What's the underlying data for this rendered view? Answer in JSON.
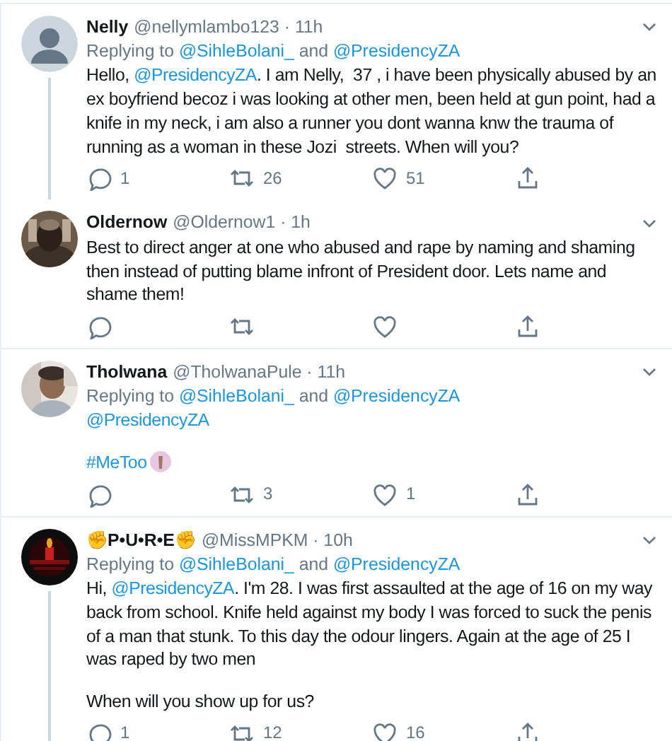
{
  "tweets": [
    {
      "avatar": {
        "kind": "default"
      },
      "thread_line": true,
      "name": [
        {
          "text": "Nelly",
          "kind": "plain"
        }
      ],
      "handle": "@nellymlambo123",
      "separator": "·",
      "time": "11h",
      "replying": {
        "prefix": "Replying to",
        "targets": [
          "@SihleBolani_",
          "@PresidencyZA"
        ],
        "joiner": "and"
      },
      "body": [
        [
          {
            "text": "Hello, ",
            "kind": "plain"
          },
          {
            "text": "@PresidencyZA",
            "kind": "mention"
          },
          {
            "text": ". I am Nelly,  37 , i have been physically abused by an ex boyfriend becoz i was looking at other men, been held at gun point, had a knife in my neck, i am also a runner you dont wanna knw the trauma of running as a woman in these Jozi  streets. When will you?",
            "kind": "plain"
          }
        ]
      ],
      "stats": {
        "replies": "1",
        "retweets": "26",
        "likes": "51"
      }
    },
    {
      "avatar": {
        "kind": "picture"
      },
      "thread_line": false,
      "name": [
        {
          "text": "Oldernow",
          "kind": "plain"
        }
      ],
      "handle": "@Oldernow1",
      "separator": "·",
      "time": "1h",
      "body": [
        [
          {
            "text": "Best to direct anger at one who abused and rape by naming and shaming then instead of putting blame infront of President door. Lets name and shame them!",
            "kind": "plain"
          }
        ]
      ]
    },
    {
      "avatar": {
        "kind": "picture"
      },
      "thread_line": false,
      "name": [
        {
          "text": "Tholwana",
          "kind": "plain"
        }
      ],
      "handle": "@TholwanaPule",
      "separator": "·",
      "time": "11h",
      "replying": {
        "prefix": "Replying to",
        "targets": [
          "@SihleBolani_",
          "@PresidencyZA"
        ],
        "joiner": "and"
      },
      "body": [
        [
          {
            "text": "@PresidencyZA",
            "kind": "mention"
          }
        ],
        [
          {
            "text": "#MeToo",
            "kind": "mention"
          },
          {
            "kind": "emoji-icon"
          }
        ]
      ],
      "stats": {
        "retweets": "3",
        "likes": "1"
      }
    },
    {
      "avatar": {
        "kind": "picture"
      },
      "thread_line": true,
      "name": [
        {
          "text": "✊",
          "kind": "emoji"
        },
        {
          "text": "P•U•R•E",
          "kind": "plain"
        },
        {
          "text": "✊",
          "kind": "emoji"
        }
      ],
      "handle": "@MissMPKM",
      "separator": "·",
      "time": "10h",
      "replying": {
        "prefix": "Replying to",
        "targets": [
          "@SihleBolani_",
          "@PresidencyZA"
        ],
        "joiner": "and"
      },
      "body": [
        [
          {
            "text": "Hi, ",
            "kind": "plain"
          },
          {
            "text": "@PresidencyZA",
            "kind": "mention"
          },
          {
            "text": ". I'm 28. I was first assaulted at the age of 16 on my way back from school. Knife held against my body I was forced to suck the penis of a man that stunk. To this day the odour lingers. Again at the age of 25 I was raped by two men",
            "kind": "plain"
          }
        ],
        [
          {
            "text": "When will you show up for us?",
            "kind": "plain"
          }
        ]
      ],
      "stats": {
        "replies": "1",
        "retweets": "12",
        "likes": "16"
      }
    }
  ]
}
